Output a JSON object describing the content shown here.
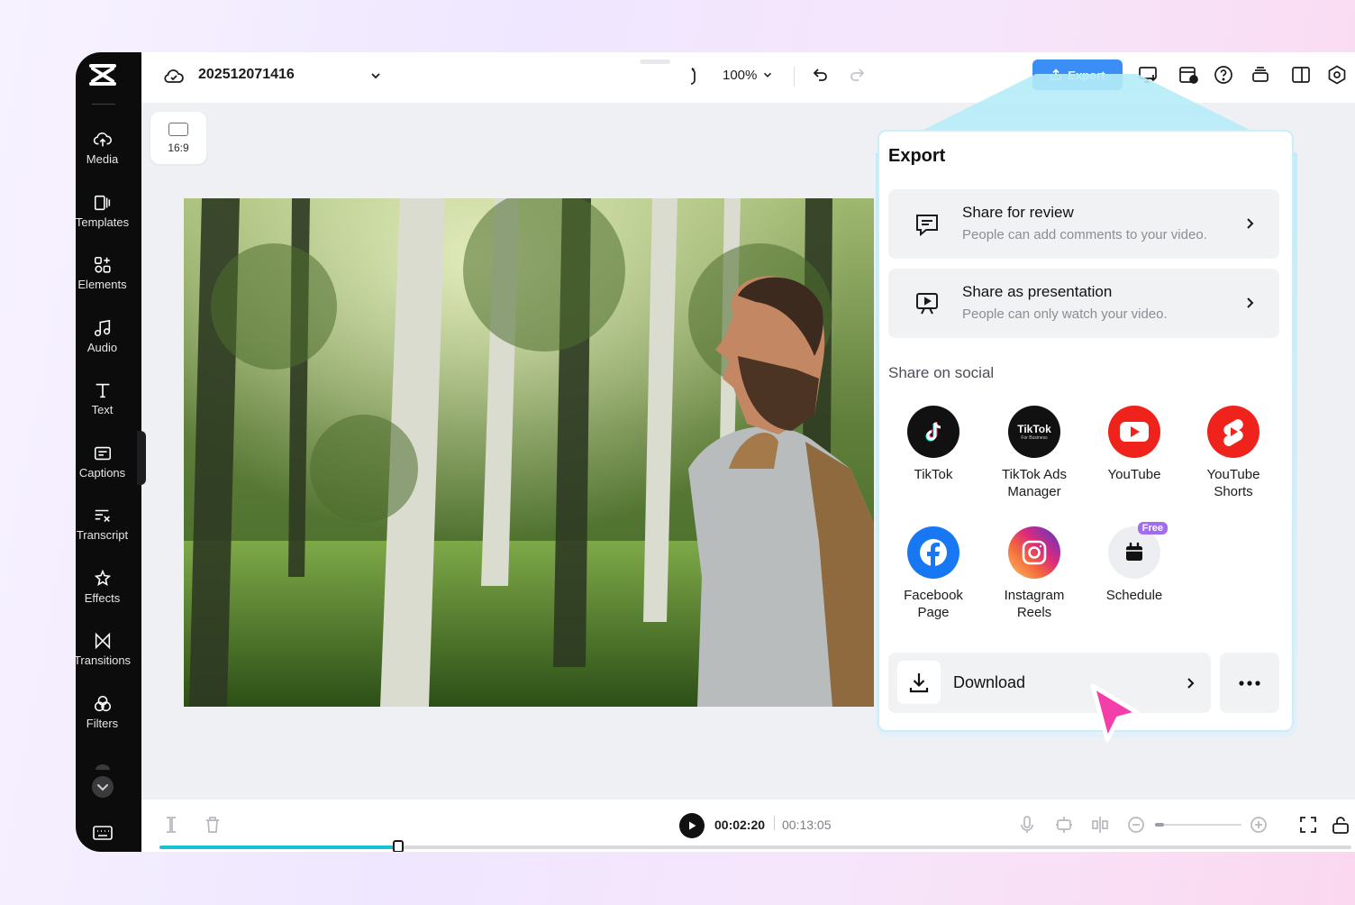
{
  "project": {
    "name": "202512071416"
  },
  "toolbar": {
    "zoom": "100%",
    "export_label": "Export"
  },
  "canvas": {
    "ratio": "16:9"
  },
  "sidebar": {
    "items": [
      {
        "label": "Media",
        "icon": "cloud-upload-icon"
      },
      {
        "label": "Templates",
        "icon": "templates-icon"
      },
      {
        "label": "Elements",
        "icon": "elements-icon"
      },
      {
        "label": "Audio",
        "icon": "music-note-icon"
      },
      {
        "label": "Text",
        "icon": "text-icon"
      },
      {
        "label": "Captions",
        "icon": "captions-icon"
      },
      {
        "label": "Transcript",
        "icon": "transcript-icon"
      },
      {
        "label": "Effects",
        "icon": "effects-icon"
      },
      {
        "label": "Transitions",
        "icon": "transitions-icon"
      },
      {
        "label": "Filters",
        "icon": "filters-icon"
      }
    ]
  },
  "export_panel": {
    "title": "Export",
    "share_review": {
      "title": "Share for review",
      "subtitle": "People can add comments to your video."
    },
    "share_presentation": {
      "title": "Share as presentation",
      "subtitle": "People can only watch your video."
    },
    "social_heading": "Share on social",
    "social": [
      {
        "label": "TikTok",
        "icon": "tiktok-icon"
      },
      {
        "label": "TikTok Ads Manager",
        "icon": "tiktok-business-icon",
        "logo_text": "TikTok",
        "logo_sub": "For Business"
      },
      {
        "label": "YouTube",
        "icon": "youtube-icon"
      },
      {
        "label": "YouTube Shorts",
        "icon": "youtube-shorts-icon"
      },
      {
        "label": "Facebook Page",
        "icon": "facebook-icon"
      },
      {
        "label": "Instagram Reels",
        "icon": "instagram-icon"
      },
      {
        "label": "Schedule",
        "icon": "calendar-icon",
        "badge": "Free"
      }
    ],
    "download_label": "Download"
  },
  "playback": {
    "current": "00:02:20",
    "total": "00:13:05",
    "progress": 0.2
  },
  "colors": {
    "accent": "#3b8ef5",
    "progress": "#19c2d3",
    "cursor": "#f43fa8"
  }
}
